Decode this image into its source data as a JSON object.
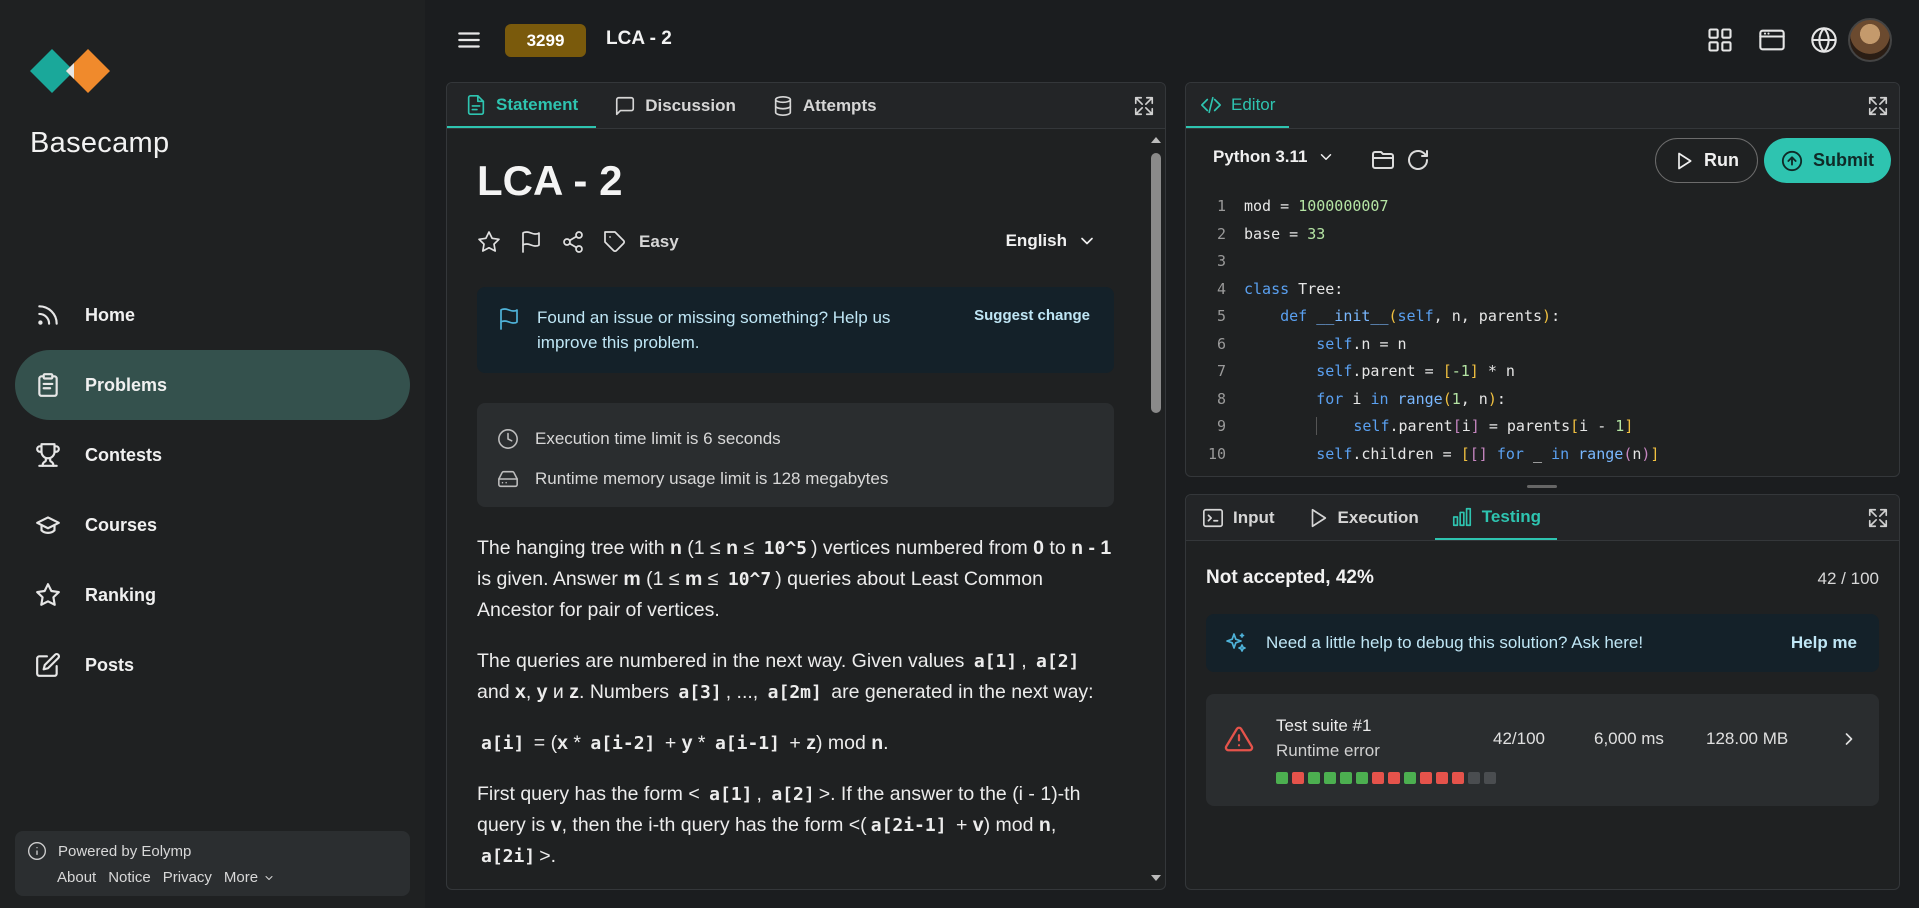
{
  "brand": {
    "name": "Basecamp",
    "colors": {
      "teal": "#1aa89a",
      "orange": "#f08a2c"
    }
  },
  "sidebar": {
    "items": [
      {
        "label": "Home",
        "icon": "rss-icon",
        "active": false
      },
      {
        "label": "Problems",
        "icon": "clipboard-icon",
        "active": true
      },
      {
        "label": "Contests",
        "icon": "trophy-icon",
        "active": false
      },
      {
        "label": "Courses",
        "icon": "graduation-cap-icon",
        "active": false
      },
      {
        "label": "Ranking",
        "icon": "star-icon",
        "active": false
      },
      {
        "label": "Posts",
        "icon": "edit-icon",
        "active": false
      }
    ],
    "footer": {
      "powered": "Powered by Eolymp",
      "links": [
        "About",
        "Notice",
        "Privacy",
        "More"
      ]
    }
  },
  "header": {
    "problem_id": "3299",
    "title": "LCA - 2"
  },
  "statement": {
    "tabs": [
      {
        "label": "Statement",
        "active": true
      },
      {
        "label": "Discussion",
        "active": false
      },
      {
        "label": "Attempts",
        "active": false
      }
    ],
    "title": "LCA - 2",
    "difficulty": "Easy",
    "language": "English",
    "issue_text": "Found an issue or missing something? Help us improve this problem.",
    "suggest_label": "Suggest change",
    "time_limit": "Execution time limit is 6 seconds",
    "memory_limit": "Runtime memory usage limit is 128 megabytes",
    "p1": {
      "a": "The hanging tree with ",
      "n1": "n",
      "b": " (1 ≤ ",
      "n2": "n",
      "c": " ≤ ",
      "e1": "10^5",
      "d": ") vertices numbered from ",
      "z": "0",
      "e": " to ",
      "nm1": "n - 1",
      "f": " is given. Answer ",
      "m1": "m",
      "g": " (1 ≤ ",
      "m2": "m",
      "h": " ≤ ",
      "e2": "10^7",
      "i": ") queries about Least Common Ancestor for pair of vertices."
    },
    "p2": {
      "a": "The queries are numbered in the next way. Given values ",
      "a1": "a[1]",
      "b": ", ",
      "a2": "a[2]",
      "c": " and ",
      "x": "x",
      "d": ", ",
      "y": "y",
      "e": " и ",
      "z": "z",
      "f": ". Numbers ",
      "a3": "a[3]",
      "g": ", ..., ",
      "a2m": "a[2m]",
      "h": " are generated in the next way:"
    },
    "p3": {
      "ai": "a[i]",
      "a": " = (",
      "x": "x",
      "b": " * ",
      "ai2": "a[i-2]",
      "c": " + ",
      "y": "y",
      "d": " * ",
      "ai1": "a[i-1]",
      "e": " + ",
      "z": "z",
      "f": ") mod ",
      "n": "n",
      "g": "."
    },
    "p4": {
      "a": "First query has the form < ",
      "a1": "a[1]",
      "b": ", ",
      "a2": "a[2]",
      "c": ">. If the answer to the (i - 1)-th query is ",
      "v": "v",
      "d": ", then the i-th query has the form <(",
      "a2i1": "a[2i-1]",
      "e": " + ",
      "v2": "v",
      "f": ") mod ",
      "n": "n",
      "g": ", ",
      "a2i": "a[2i]",
      "h": ">."
    }
  },
  "editor": {
    "tab": "Editor",
    "language": "Python 3.11",
    "run_label": "Run",
    "submit_label": "Submit",
    "line_numbers": [
      "1",
      "2",
      "3",
      "4",
      "5",
      "6",
      "7",
      "8",
      "9",
      "10"
    ]
  },
  "output": {
    "tabs": [
      {
        "label": "Input",
        "active": false
      },
      {
        "label": "Execution",
        "active": false
      },
      {
        "label": "Testing",
        "active": true
      }
    ],
    "verdict": "Not accepted, 42%",
    "score": "42 / 100",
    "help_text": "Need a little help to debug this solution? Ask here!",
    "help_button": "Help me",
    "suite": {
      "name": "Test suite #1",
      "status": "Runtime error",
      "points": "42/100",
      "time": "6,000 ms",
      "memory": "128.00 MB",
      "results": [
        "pass",
        "fail",
        "pass",
        "pass",
        "pass",
        "pass",
        "fail",
        "fail",
        "pass",
        "fail",
        "fail",
        "fail",
        "none",
        "none"
      ]
    },
    "colors": {
      "pass": "#4caf50",
      "fail": "#e5534b",
      "none": "#4a4d50"
    }
  }
}
